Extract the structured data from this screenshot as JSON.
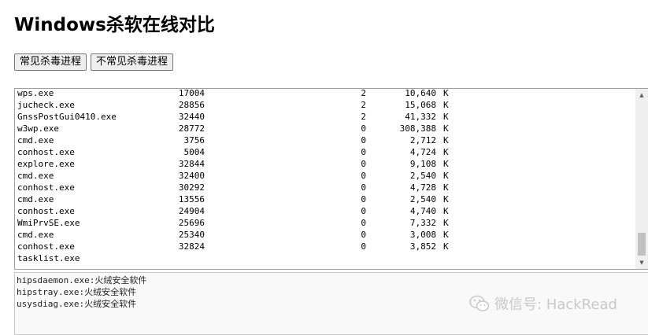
{
  "page": {
    "title": "Windows杀软在线对比"
  },
  "buttons": {
    "common_av": "常见杀毒进程",
    "uncommon_av": "不常见杀毒进程"
  },
  "process_list": {
    "rows": [
      {
        "name": "wps.exe",
        "pid": "17004",
        "session": "2",
        "mem": "10,640",
        "unit": "K"
      },
      {
        "name": "jucheck.exe",
        "pid": "28856",
        "session": "2",
        "mem": "15,068",
        "unit": "K"
      },
      {
        "name": "GnssPostGui0410.exe",
        "pid": "32440",
        "session": "2",
        "mem": "41,332",
        "unit": "K"
      },
      {
        "name": "w3wp.exe",
        "pid": "28772",
        "session": "0",
        "mem": "308,388",
        "unit": "K"
      },
      {
        "name": "cmd.exe",
        "pid": "3756",
        "session": "0",
        "mem": "2,712",
        "unit": "K"
      },
      {
        "name": "conhost.exe",
        "pid": "5004",
        "session": "0",
        "mem": "4,724",
        "unit": "K"
      },
      {
        "name": "explore.exe",
        "pid": "32844",
        "session": "0",
        "mem": "9,108",
        "unit": "K"
      },
      {
        "name": "cmd.exe",
        "pid": "32400",
        "session": "0",
        "mem": "2,540",
        "unit": "K"
      },
      {
        "name": "conhost.exe",
        "pid": "30292",
        "session": "0",
        "mem": "4,728",
        "unit": "K"
      },
      {
        "name": "cmd.exe",
        "pid": "13556",
        "session": "0",
        "mem": "2,540",
        "unit": "K"
      },
      {
        "name": "conhost.exe",
        "pid": "24904",
        "session": "0",
        "mem": "4,740",
        "unit": "K"
      },
      {
        "name": "WmiPrvSE.exe",
        "pid": "25696",
        "session": "0",
        "mem": "7,332",
        "unit": "K"
      },
      {
        "name": "cmd.exe",
        "pid": "25340",
        "session": "0",
        "mem": "3,008",
        "unit": "K"
      },
      {
        "name": "conhost.exe",
        "pid": "32824",
        "session": "0",
        "mem": "3,852",
        "unit": "K"
      },
      {
        "name": "tasklist.exe",
        "pid": "",
        "session": "",
        "mem": "",
        "unit": ""
      }
    ]
  },
  "av_results": {
    "rows": [
      {
        "process": "hipsdaemon.exe",
        "separator": ":",
        "product": "火绒安全软件"
      },
      {
        "process": "hipstray.exe",
        "separator": ":",
        "product": "火绒安全软件"
      },
      {
        "process": "usysdiag.exe",
        "separator": ":",
        "product": "火绒安全软件"
      }
    ]
  },
  "watermark": {
    "text": "微信号: HackRead",
    "icon": "wechat-icon"
  }
}
